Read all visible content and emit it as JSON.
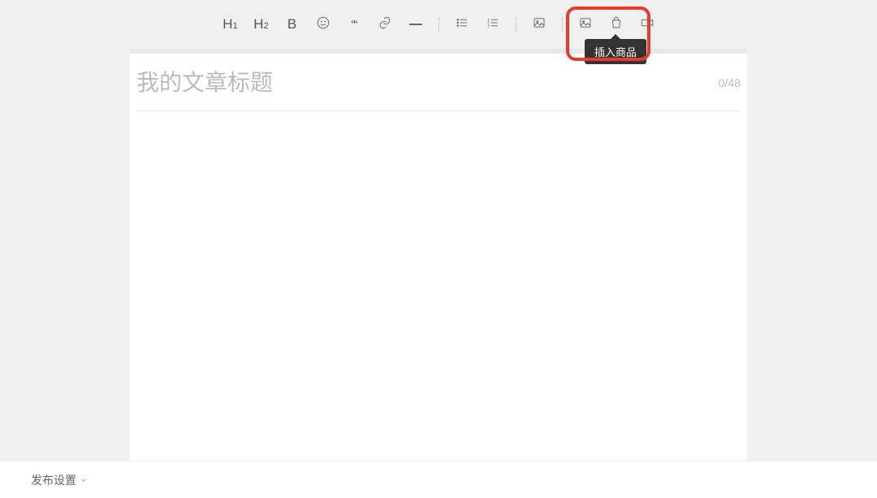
{
  "toolbar": {
    "h1_label": "H",
    "h1_sub": "1",
    "h2_label": "H",
    "h2_sub": "2",
    "bold_label": "B",
    "quote_label": "““"
  },
  "tooltip": {
    "insert_product": "插入商品"
  },
  "editor": {
    "title_placeholder": "我的文章标题",
    "char_count": "0/48"
  },
  "footer": {
    "publish_settings": "发布设置"
  }
}
